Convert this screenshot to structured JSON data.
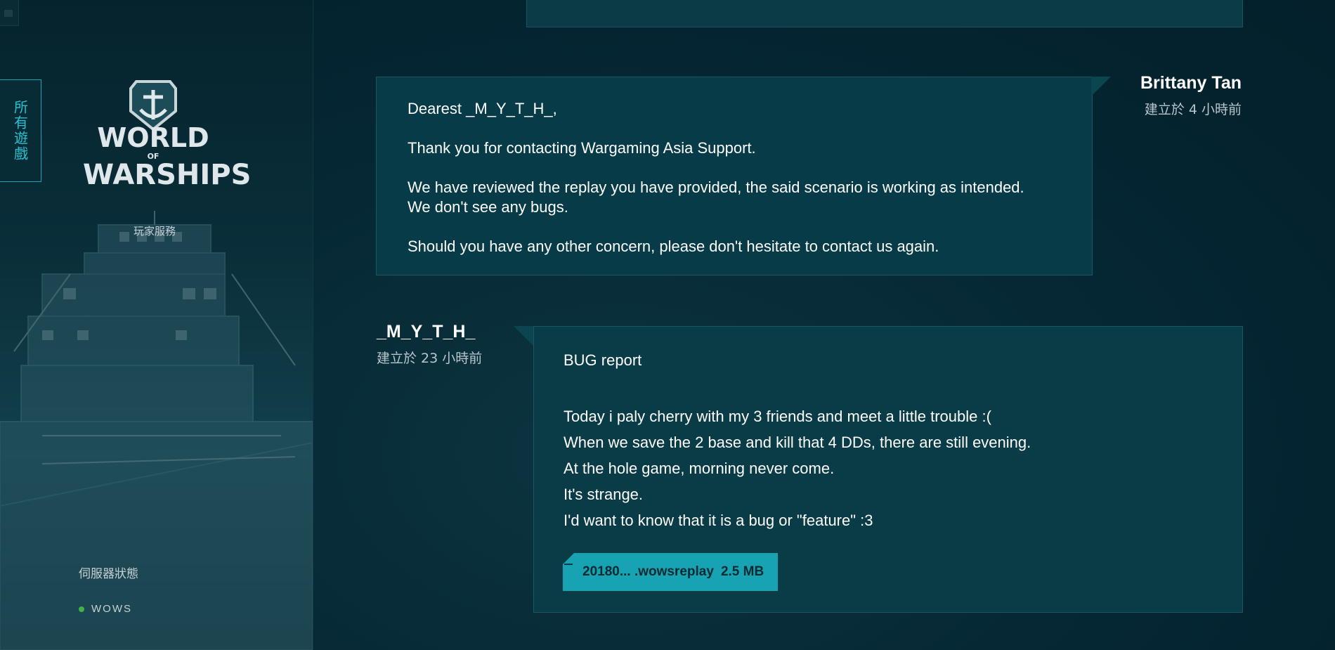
{
  "sidebar": {
    "all_games_label": "所有遊戲",
    "logo": {
      "line1": "WORLD",
      "line2": "OF",
      "line3": "WARSHIPS"
    },
    "player_service": "玩家服務",
    "server_status_title": "伺服器狀態",
    "servers": [
      {
        "name": "WOWS",
        "status_color": "#3fb24a"
      }
    ]
  },
  "messages": [
    {
      "author": "Brittany Tan",
      "created": "建立於 4 小時前",
      "lines": [
        "Dearest _M_Y_T_H_,",
        "Thank you for contacting Wargaming Asia Support.",
        "We have reviewed the replay you have provided, the said scenario is working as intended.",
        "We don't see any bugs.",
        "Should you have any other concern, please don't hesitate to contact us again."
      ]
    },
    {
      "author": "_M_Y_T_H_",
      "created": "建立於 23 小時前",
      "lines": [
        "BUG report",
        "Today i paly cherry with my 3 friends and meet a little trouble :(",
        "When we save the 2 base and kill that 4 DDs, there are still evening.",
        "At the hole game, morning never come.",
        "It's strange.",
        "I'd want to know that it is a bug or \"feature\" :3"
      ],
      "attachment": {
        "name": "20180... .wowsreplay",
        "size": "2.5 MB"
      }
    }
  ],
  "colors": {
    "accent": "#17a3b1",
    "bubble": "#073b47",
    "background": "#042430"
  }
}
